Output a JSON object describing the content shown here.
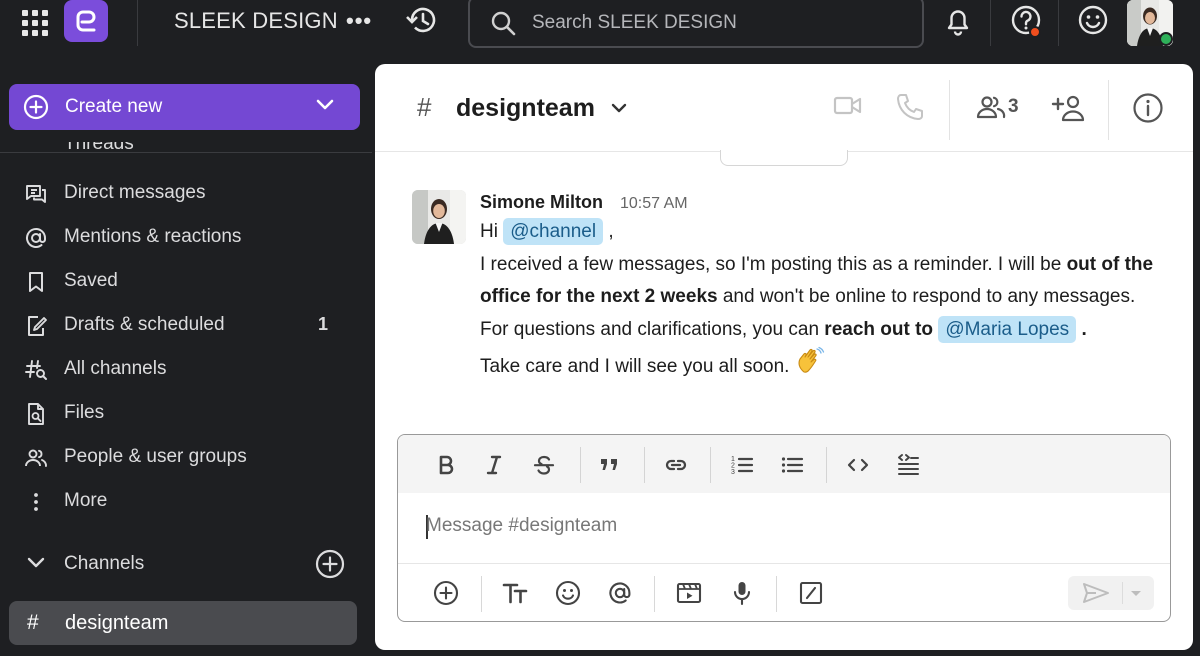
{
  "app": {
    "team_name": "SLEEK DESIGN"
  },
  "search": {
    "placeholder": "Search SLEEK DESIGN"
  },
  "sidebar": {
    "create_label": "Create new",
    "partial_item_label": "Threads",
    "items": [
      {
        "label": "Direct messages",
        "icon": "direct-messages-icon"
      },
      {
        "label": "Mentions & reactions",
        "icon": "at-icon"
      },
      {
        "label": "Saved",
        "icon": "bookmark-icon"
      },
      {
        "label": "Drafts & scheduled",
        "icon": "drafts-icon",
        "count": "1"
      },
      {
        "label": "All channels",
        "icon": "browse-channels-icon"
      },
      {
        "label": "Files",
        "icon": "files-icon"
      },
      {
        "label": "People & user groups",
        "icon": "people-icon"
      },
      {
        "label": "More",
        "icon": "more-vertical-icon"
      }
    ],
    "channels_header": "Channels",
    "active_channel": "designteam"
  },
  "channel": {
    "name": "designteam",
    "member_count": "3"
  },
  "message": {
    "author": "Simone Milton",
    "time": "10:57 AM",
    "greeting": "Hi",
    "channel_mention": "@channel",
    "comma": ",",
    "line1_a": "I received a few messages, so I'm posting this as a reminder. I will be",
    "line1_bold": "out of the office for the next 2 weeks",
    "line1_b": "and won't be online to respond to any messages.",
    "line2_a": "For questions and clarifications, you can",
    "line2_bold": "reach out to",
    "user_mention": "@Maria Lopes",
    "period": ".",
    "line3": "Take care and I will see you all soon."
  },
  "composer": {
    "placeholder": "Message #designteam"
  },
  "colors": {
    "brand_purple": "#7448d3",
    "mention_bg": "#bfe3f7",
    "status_online": "#2fb15a",
    "notification_dot": "#f04e1e"
  }
}
